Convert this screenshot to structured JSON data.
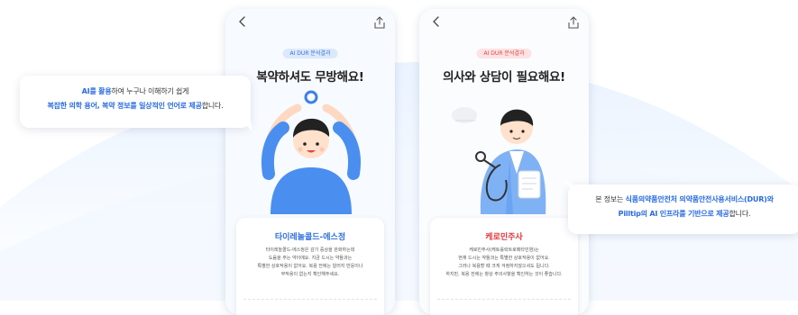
{
  "left_phone": {
    "badge": "AI DUR 분석결과",
    "headline": "복약하셔도 무방해요!",
    "card_title": "타이레놀콜드-에스정",
    "card_desc": [
      "타이레놀콜드-에스정은 감기 증상을 완화하는데",
      "도움을 주는 약이에요. 지금 드시는 약들과는",
      "특별한 상호작용이 없어요. 복용 전에는 알러지 반응이나",
      "부작용이 없는지 확인해주세요."
    ]
  },
  "right_phone": {
    "badge": "AI DUR 분석결과",
    "headline": "의사와 상담이 필요해요!",
    "card_title": "케로민주사",
    "card_desc": [
      "케로민주사(케토롤락트로메타민염)는",
      "현재 드시는 약들과는 특별한 상호작용이 없어요.",
      "그러나 복용할 때 크게 걱정하지않으셔도 됩니다.",
      "하지만, 복용 전에는 항상 주의사항을 확인하는 것이 좋습니다."
    ]
  },
  "bubble_left": {
    "line1_hl": "AI를 활용",
    "line1_rest": "하여 누구나 이해하기 쉽게",
    "line2_hl": "복잡한 의학 용어, 복약 정보를 일상적인 언어로 제공",
    "line2_rest": "합니다."
  },
  "bubble_right": {
    "line1_pre": "본 정보는 ",
    "line1_hl": "식품의약품안전처 의약품안전사용서비스(DUR)와",
    "line2_hl": "Pilltip의 AI 인프라를 기반으로 제공",
    "line2_rest": "합니다."
  },
  "colors": {
    "accent_blue": "#2a6be0",
    "alert_red": "#e0383e",
    "badge_ok_bg": "#dce9fb",
    "badge_warn_bg": "#fde3e3"
  },
  "icons": [
    "back-arrow-icon",
    "share-icon"
  ]
}
